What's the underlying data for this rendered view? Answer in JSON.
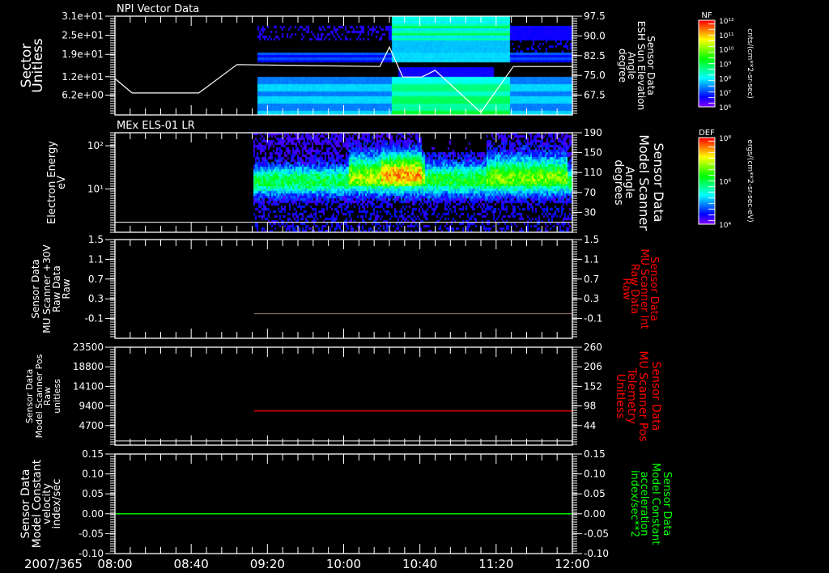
{
  "colors": {
    "background": "#000000",
    "axis": "#ffffff",
    "red": "#ff0000",
    "green": "#00ff00",
    "gray": "#888888"
  },
  "chart_data": [
    {
      "type": "heatmap",
      "title": "NPI Vector Data",
      "ylabel_left": [
        "Sector",
        "Unitless"
      ],
      "ylabel_right": [
        "Sensor Data",
        "ESH Sun Elevation",
        "Angle",
        "degree"
      ],
      "ylim": [
        0,
        31
      ],
      "yticks": [
        31,
        25,
        19,
        12,
        6.2
      ],
      "ytick_labels": [
        "3.1e+01",
        "2.5e+01",
        "1.9e+01",
        "1.2e+01",
        "6.2e+00"
      ],
      "ylim_right": [
        60,
        97.5
      ],
      "yticks_right": [
        97.5,
        90.0,
        82.5,
        75.0,
        67.5
      ],
      "ytick_labels_right": [
        "97.5",
        "90.0",
        "82.5",
        "75.0",
        "67.5"
      ],
      "data_start_min": 75,
      "line": {
        "name": "Sun Elevation",
        "x_min": [
          0,
          9,
          44,
          64,
          139,
          144,
          151,
          161,
          168,
          192,
          209,
          240
        ],
        "y": [
          11.4,
          6.9,
          6.9,
          15.8,
          15.2,
          21.3,
          11.9,
          11.9,
          14.0,
          0.8,
          15.2,
          15.2
        ]
      },
      "colorbar": {
        "label": "NF",
        "ticks": [
          "10¹²",
          "10¹¹",
          "10¹⁰",
          "10⁹",
          "10⁸",
          "10⁷",
          "10⁶"
        ],
        "units": "cnts/(cm**2-sr-sec)"
      }
    },
    {
      "type": "heatmap",
      "title": "MEx ELS-01 LR",
      "ylabel_left": [
        "Electron Energy",
        "eV"
      ],
      "ylabel_right": [
        "Sensor Data",
        "Model Scanner",
        "Angle",
        "degrees"
      ],
      "yscale": "log",
      "ylim": [
        1,
        200
      ],
      "yticks": [
        100,
        10
      ],
      "ytick_labels": [
        "10²",
        "10¹"
      ],
      "ylim_right": [
        -10,
        190
      ],
      "yticks_right": [
        190,
        150,
        110,
        70,
        30
      ],
      "ytick_labels_right": [
        "190",
        "150",
        "110",
        "70",
        "30"
      ],
      "data_start_min": 73,
      "hline": 1.7,
      "colorbar": {
        "label": "DEF",
        "ticks": [
          "10⁸",
          "10⁶",
          "10⁴"
        ],
        "units": "ergs/(cm**2-sr-sec-eV)"
      }
    },
    {
      "type": "line",
      "ylabel_left": [
        "Sensor Data",
        "MU Scanner +30V",
        "Raw Data",
        "Raw"
      ],
      "ylabel_right": [
        "Sensor Data",
        "MU Scanner Int",
        "Raw Data",
        "Raw"
      ],
      "ylim": [
        -0.5,
        1.5
      ],
      "yticks": [
        1.5,
        1.1,
        0.7,
        0.3,
        -0.1
      ],
      "ytick_labels": [
        "1.5",
        "1.1",
        "0.7",
        "0.3",
        "-0.1"
      ],
      "ylim_right": [
        -0.5,
        1.5
      ],
      "yticks_right": [
        1.5,
        1.1,
        0.7,
        0.3,
        -0.1
      ],
      "ytick_labels_right": [
        "1.5",
        "1.1",
        "0.7",
        "0.3",
        "-0.1"
      ],
      "series": [
        {
          "name": "MU Scanner Int",
          "x_min": [
            73,
            240
          ],
          "y": [
            0.0,
            0.0
          ],
          "color": "#886666"
        }
      ]
    },
    {
      "type": "line",
      "ylabel_left": [
        "Sensor Data",
        "Model Scanner Pos",
        "Raw",
        "unitless"
      ],
      "ylabel_right": [
        "Sensor Data",
        "MU Scanner Pos",
        "Telemetry",
        "Unitless"
      ],
      "ylim": [
        0,
        23500
      ],
      "yticks": [
        23500,
        18800,
        14100,
        9400,
        4700
      ],
      "ytick_labels": [
        "23500",
        "18800",
        "14100",
        "9400",
        "4700"
      ],
      "ylim_right": [
        -10,
        260
      ],
      "yticks_right": [
        260,
        206,
        152,
        98,
        44
      ],
      "ytick_labels_right": [
        "260",
        "206",
        "152",
        "98",
        "44"
      ],
      "hline": 1000,
      "series": [
        {
          "name": "MU Scanner Pos",
          "x_min": [
            73,
            240
          ],
          "y": [
            8200,
            8200
          ],
          "color": "#ff0000"
        }
      ]
    },
    {
      "type": "line",
      "ylabel_left": [
        "Sensor Data",
        "Model Constant",
        "velocity",
        "index/sec"
      ],
      "ylabel_right": [
        "Sensor Data",
        "Model Constant",
        "acceleration",
        "index/sec**2"
      ],
      "ylim": [
        -0.1,
        0.15
      ],
      "yticks": [
        0.15,
        0.1,
        0.05,
        0.0,
        -0.05,
        -0.1
      ],
      "ytick_labels": [
        "0.15",
        "0.10",
        "0.05",
        "0.00",
        "-0.05",
        "-0.10"
      ],
      "ylim_right": [
        -0.1,
        0.15
      ],
      "yticks_right": [
        0.15,
        0.1,
        0.05,
        0.0,
        -0.05,
        -0.1
      ],
      "ytick_labels_right": [
        "0.15",
        "0.10",
        "0.05",
        "0.00",
        "-0.05",
        "-0.10"
      ],
      "series": [
        {
          "name": "velocity",
          "x_min": [
            0,
            240
          ],
          "y": [
            0,
            0
          ],
          "color": "#00ff00"
        }
      ]
    }
  ],
  "xaxis": {
    "date": "2007/365",
    "tick_labels": [
      "08:00",
      "08:40",
      "09:20",
      "10:00",
      "10:40",
      "11:20",
      "12:00"
    ],
    "range_min": [
      0,
      240
    ]
  }
}
